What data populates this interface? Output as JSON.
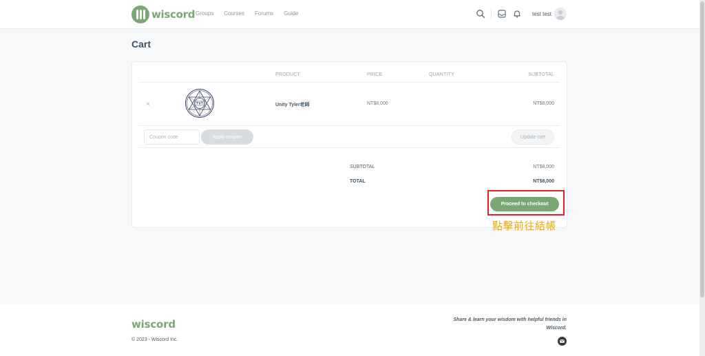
{
  "header": {
    "logo_text": "wiscord",
    "nav": [
      "Groups",
      "Courses",
      "Forums",
      "Guide"
    ],
    "user_name": "test test",
    "icons": [
      "search-icon",
      "inbox-icon",
      "bell-icon"
    ]
  },
  "page": {
    "title": "Cart"
  },
  "cart": {
    "columns": {
      "product": "PRODUCT",
      "price": "PRICE",
      "quantity": "QUANTITY",
      "subtotal": "SUBTOTAL"
    },
    "items": [
      {
        "remove": "×",
        "name": "Unity Tyler老師",
        "price": "NT$8,000",
        "subtotal": "NT$8,000"
      }
    ],
    "coupon_placeholder": "Coupon code",
    "apply_coupon": "Apply coupon",
    "update_cart": "Update cart"
  },
  "totals": {
    "subtotal_label": "SUBTOTAL",
    "subtotal_value": "NT$8,000",
    "total_label": "TOTAL",
    "total_value": "NT$8,000",
    "checkout_label": "Proceed to checkout"
  },
  "annotation": {
    "text": "點擊前往結帳",
    "color": "#f0a500",
    "box_color": "#e02020"
  },
  "footer": {
    "logo_text": "wiscord",
    "copyright": "© 2023 - Wiscord Inc.",
    "tagline": "Share & learn your wisdom with helpful friends in Wiscord."
  },
  "colors": {
    "brand": "#7aa874",
    "text": "#4b5a66"
  }
}
